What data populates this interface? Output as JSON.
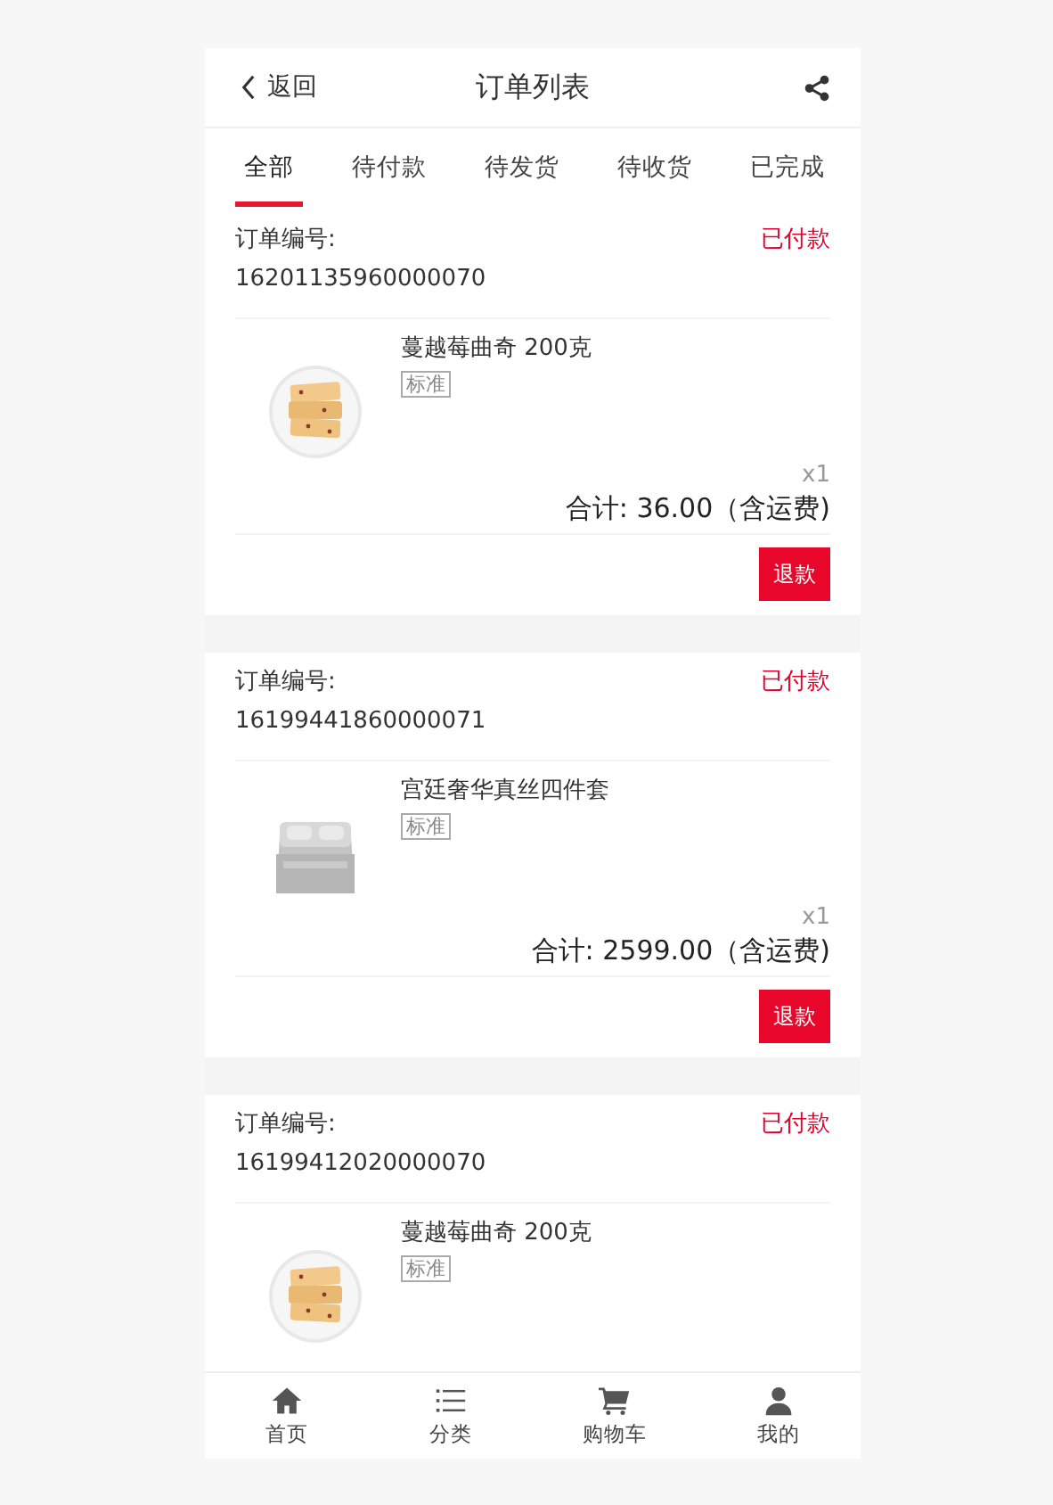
{
  "header": {
    "back": "返回",
    "title": "订单列表"
  },
  "tabs": [
    {
      "label": "全部",
      "selected": true
    },
    {
      "label": "待付款",
      "selected": false
    },
    {
      "label": "待发货",
      "selected": false
    },
    {
      "label": "待收货",
      "selected": false
    },
    {
      "label": "已完成",
      "selected": false
    }
  ],
  "orders": [
    {
      "number_label": "订单编号:",
      "number": "16201135960000070",
      "status": "已付款",
      "item": {
        "name": "蔓越莓曲奇 200克",
        "spec": "标准",
        "quantity": "x1"
      },
      "total": "合计: 36.00（含运费)",
      "action": "退款"
    },
    {
      "number_label": "订单编号:",
      "number": "16199441860000071",
      "status": "已付款",
      "item": {
        "name": "宫廷奢华真丝四件套",
        "spec": "标准",
        "quantity": "x1"
      },
      "total": "合计: 2599.00（含运费)",
      "action": "退款"
    },
    {
      "number_label": "订单编号:",
      "number": "16199412020000070",
      "status": "已付款",
      "item": {
        "name": "蔓越莓曲奇 200克",
        "spec": "标准"
      }
    }
  ],
  "bottom_nav": [
    {
      "label": "首页"
    },
    {
      "label": "分类"
    },
    {
      "label": "购物车"
    },
    {
      "label": "我的"
    }
  ]
}
